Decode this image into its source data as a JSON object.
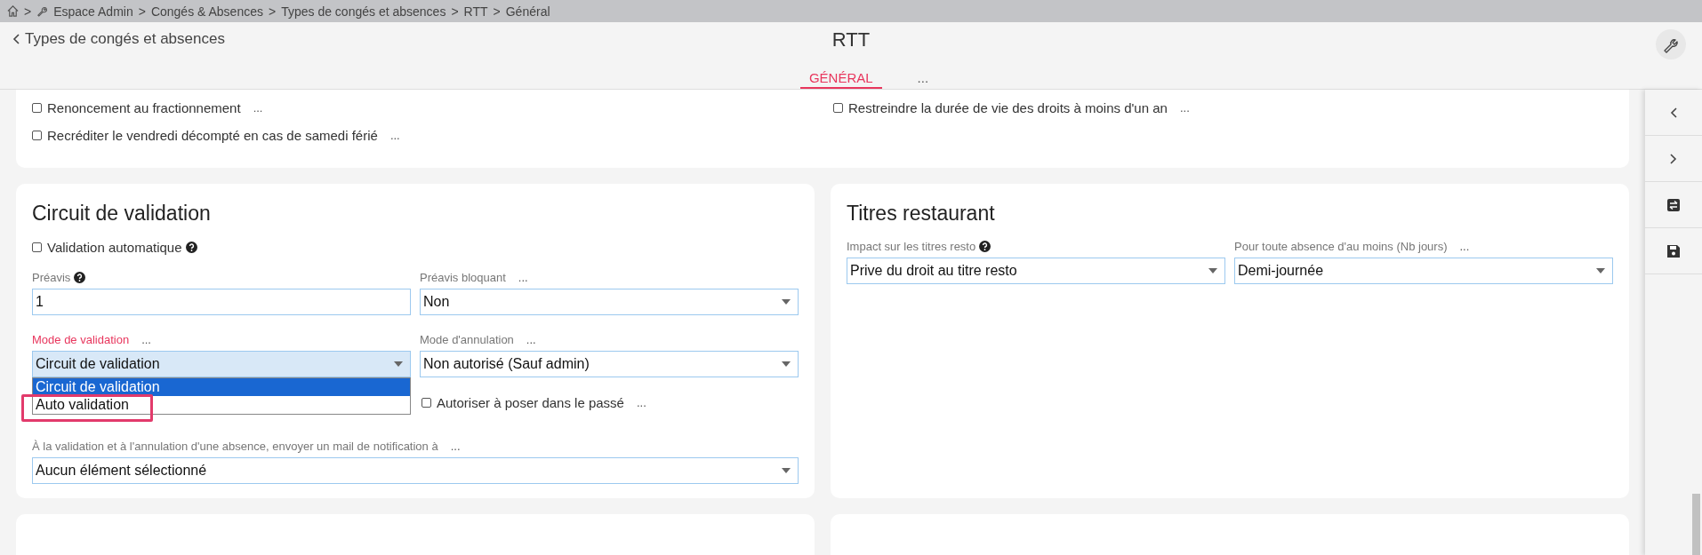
{
  "breadcrumb": {
    "separator": ">",
    "items": [
      "Espace Admin",
      "Congés & Absences",
      "Types de congés et absences",
      "RTT",
      "Général"
    ]
  },
  "header": {
    "back_link": "Types de congés et absences",
    "title": "RTT",
    "tabs": [
      {
        "label": "GÉNÉRAL",
        "selected": true
      },
      {
        "label": "...",
        "selected": false
      }
    ]
  },
  "options_card": {
    "columns": [
      [
        {
          "label": "Renoncement au fractionnement",
          "checked": false,
          "more": "..."
        },
        {
          "label": "Recréditer le vendredi décompté en cas de samedi férié",
          "checked": false,
          "more": "..."
        }
      ],
      [
        {
          "label": "Restreindre la durée de vie des droits à moins d'un an",
          "checked": false,
          "more": "..."
        }
      ]
    ]
  },
  "circuit_card": {
    "title": "Circuit de validation",
    "auto_validation": {
      "label": "Validation automatique",
      "checked": false
    },
    "fields": [
      {
        "kind": "input",
        "label": "Préavis",
        "help": true,
        "value": "1",
        "focused": false
      },
      {
        "kind": "select",
        "label": "Préavis bloquant",
        "more": "...",
        "value": "Non",
        "focused": false
      },
      {
        "kind": "select",
        "label": "Mode de validation",
        "more": "...",
        "value": "Circuit de validation",
        "focused": true,
        "options": [
          {
            "label": "Circuit de validation",
            "selected": true,
            "highlighted": false
          },
          {
            "label": "Auto validation",
            "selected": false,
            "highlighted": true
          }
        ]
      },
      {
        "kind": "select",
        "label": "Mode d'annulation",
        "more": "...",
        "value": "Non autorisé (Sauf admin)",
        "focused": false
      },
      {
        "kind": "checkbox",
        "label": "Autoriser à poser dans le passé",
        "more": "...",
        "checked": false
      },
      {
        "kind": "select",
        "wide": true,
        "label": "À la validation et à l'annulation d'une absence, envoyer un mail de notification à",
        "more": "...",
        "value": "Aucun élément sélectionné",
        "focused": false
      }
    ]
  },
  "titres_card": {
    "title": "Titres restaurant",
    "fields": [
      {
        "kind": "select",
        "label": "Impact sur les titres resto",
        "help": true,
        "value": "Prive du droit au titre resto",
        "focused": false
      },
      {
        "kind": "select",
        "label": "Pour toute absence d'au moins (Nb jours)",
        "more": "...",
        "value": "Demi-journée",
        "focused": false
      }
    ]
  }
}
